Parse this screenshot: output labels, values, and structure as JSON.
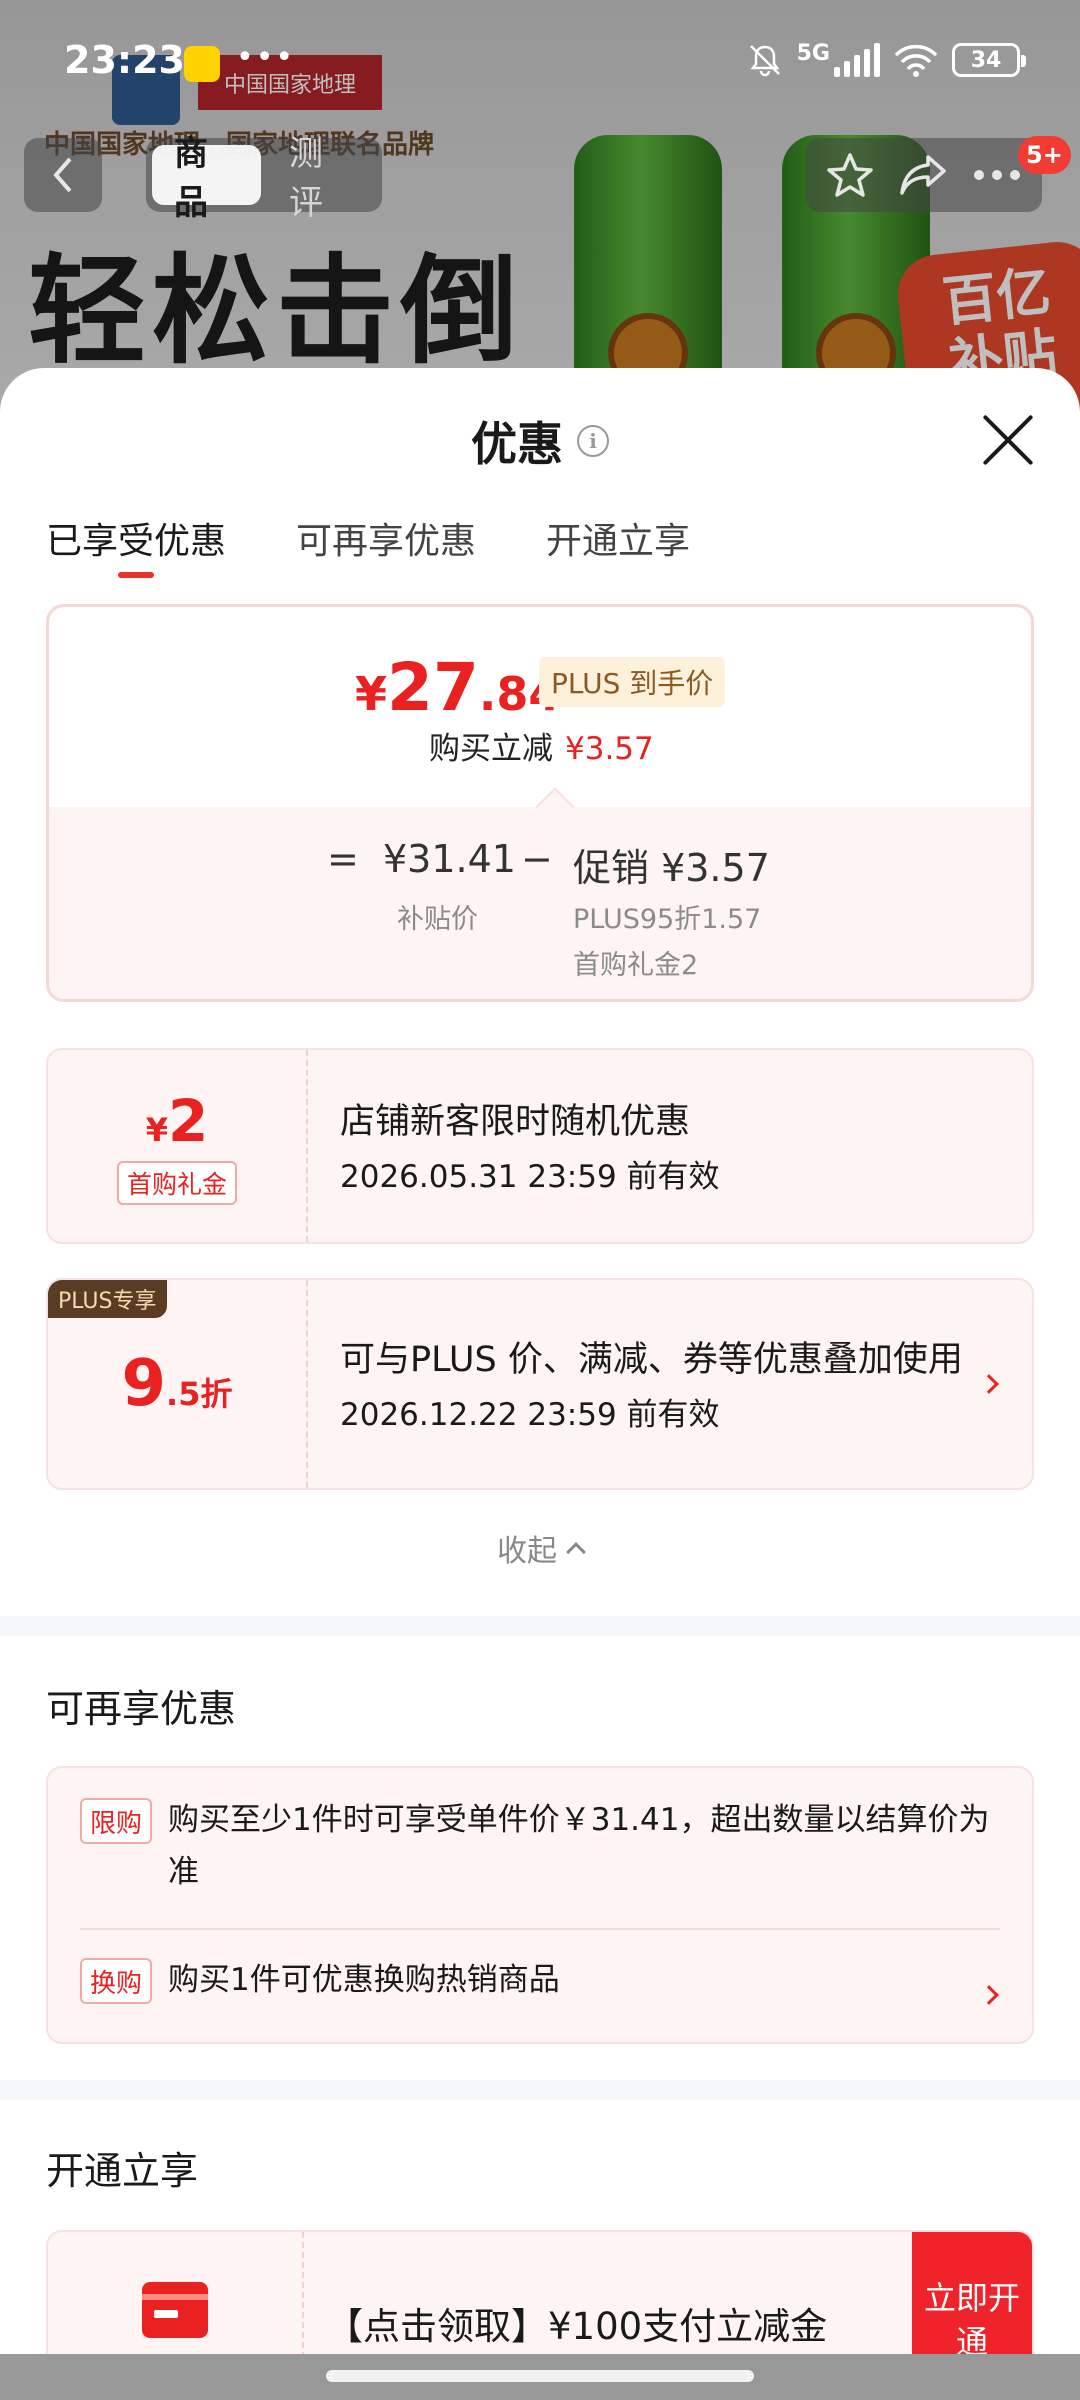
{
  "status_bar": {
    "time": "23:23",
    "network": "5G",
    "battery": "34"
  },
  "background": {
    "slogan": "轻松击倒",
    "brand_line": "中国国家地理…国家地理联名品牌",
    "partner_logo_text": "中国国家地理",
    "subsidy_badge": [
      "百亿",
      "补贴"
    ]
  },
  "nav": {
    "tabs": [
      {
        "label": "商品",
        "active": true
      },
      {
        "label": "测评",
        "active": false
      }
    ],
    "badge": "5+"
  },
  "sheet": {
    "title": "优惠",
    "tabs": [
      {
        "label": "已享受优惠",
        "active": true
      },
      {
        "label": "可再享优惠",
        "active": false
      },
      {
        "label": "开通立享",
        "active": false
      }
    ]
  },
  "price_summary": {
    "currency": "¥",
    "price_int": "27",
    "price_dec": ".84",
    "plus_label": "PLUS 到手价",
    "instant_label": "购买立减",
    "instant_value": "¥3.57",
    "equals": "=",
    "subsidy_price": "¥31.41",
    "subsidy_label": "补贴价",
    "minus": "−",
    "promo_label": "促销 ¥3.57",
    "promo_detail_1": "PLUS95折1.57",
    "promo_detail_2": "首购礼金2"
  },
  "coupons": [
    {
      "currency": "¥",
      "amount": "2",
      "tag": "首购礼金",
      "title": "店铺新客限时随机优惠",
      "date": "2026.05.31 23:59 前有效"
    },
    {
      "corner": "PLUS专享",
      "amount": "9",
      "amount_suffix": ".5折",
      "title": "可与PLUS 价、满减、券等优惠叠加使用",
      "date": "2026.12.22 23:59 前有效"
    }
  ],
  "collapse_label": "收起",
  "more_section": {
    "title": "可再享优惠",
    "rows": [
      {
        "tag": "限购",
        "text": "购买至少1件时可享受单件价￥31.41，超出数量以结算价为准"
      },
      {
        "tag": "换购",
        "text": "购买1件可优惠换购热销商品"
      }
    ]
  },
  "open_section": {
    "title": "开通立享",
    "card_text": "【点击领取】¥100支付立减金",
    "button": "立即开通"
  },
  "colors": {
    "accent_red": "#e92121",
    "plus_brown": "#5a3b24"
  }
}
